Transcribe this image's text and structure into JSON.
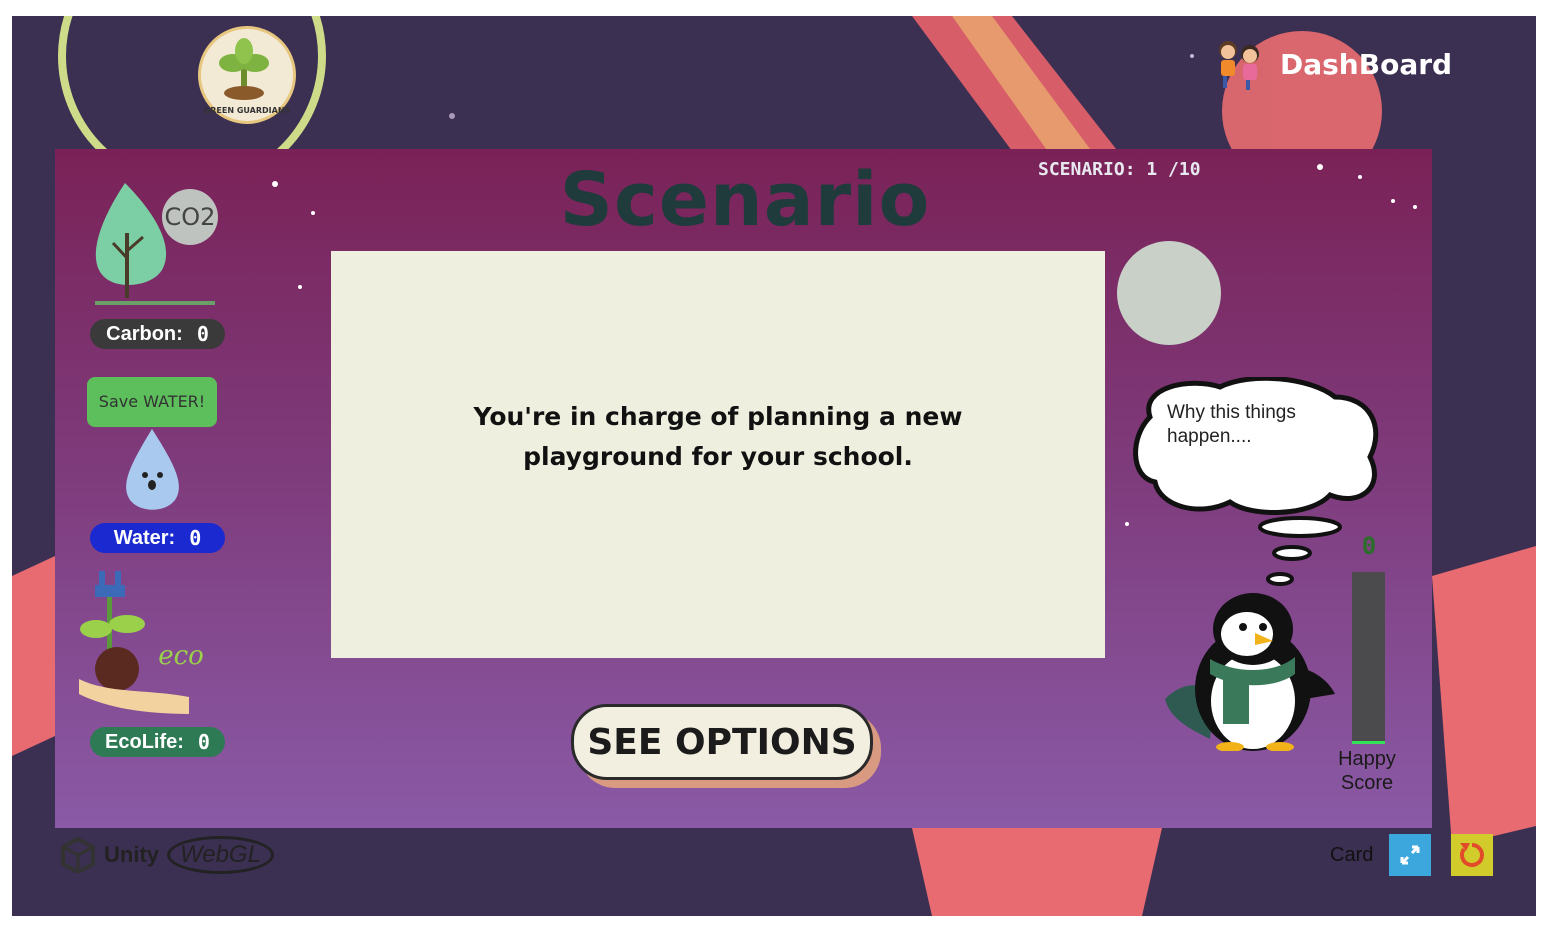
{
  "header": {
    "logo_text": "GREEN GUARDIANS",
    "dashboard_label": "DashBoard"
  },
  "scenario": {
    "title": "Scenario",
    "counter": "SCENARIO: 1 /10",
    "text": "You're in charge of planning a new playground for your school.",
    "options_label": "SEE OPTIONS"
  },
  "stats": {
    "carbon": {
      "label": "Carbon:",
      "value": "0"
    },
    "water": {
      "label": "Water:",
      "value": "0"
    },
    "ecolife": {
      "label": "EcoLife:",
      "value": "0"
    },
    "water_sign": "Save WATER!",
    "co2_label": "CO2",
    "eco_label": "eco"
  },
  "mascot": {
    "thought": "Why this things happen....",
    "happy_value": "0",
    "happy_label": "Happy Score",
    "happy_level": 0.02
  },
  "footer": {
    "unity_label": "Unity",
    "webgl_label": "WebGL",
    "card_label": "Card"
  },
  "colors": {
    "background": "#3b2f52",
    "panel_top": "#7a2257",
    "panel_bottom": "#8a5aa6",
    "title": "#1f3b3c",
    "card": "#efefdf",
    "carbon_pill": "#3a3a3a",
    "water_pill": "#1a2ad0",
    "eco_pill": "#2e7a54"
  }
}
